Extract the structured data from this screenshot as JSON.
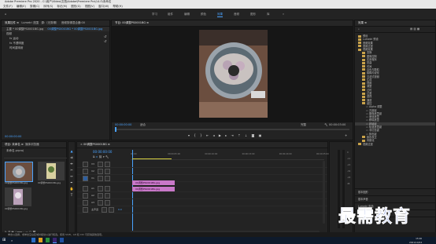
{
  "app": {
    "title": "Adobe Premiere Pro 2020 - C:\\用户\\Video\\文档\\Adobe\\Premiere Pro\\14.0\\未命名",
    "menu": [
      "文件(F)",
      "编辑(E)",
      "剪辑(C)",
      "序列(S)",
      "标记(M)",
      "图形(G)",
      "视图(V)",
      "窗口(W)",
      "帮助(H)"
    ],
    "workspaces": [
      "学习",
      "组件",
      "编辑",
      "颜色",
      "效果",
      "音频",
      "图形",
      "库"
    ],
    "active_workspace": "效果"
  },
  "effect_controls": {
    "tabs": [
      "效果控件 ≡",
      "Lumetri 范围",
      "源:（无剪辑）",
      "音频剪辑混合器:00"
    ],
    "source": "主要 * 00调整PS0001BG.jpg",
    "sequence": "00调整PS0001BG * 00调整PS0001BG.jpg",
    "items": [
      "视频",
      "fx  运动",
      "fx  不透明度",
      "时间重映射"
    ],
    "timecode": "00:00:00:00"
  },
  "program_monitor": {
    "tab": "节目: 00调整PS0001BG ≡",
    "timecode_left": "00:00:00:00",
    "fit": "适合",
    "ratio": "完整",
    "timecode_right": "00:00:03:00"
  },
  "effects_panel": {
    "tab": "效果 ≡",
    "items": [
      {
        "label": "预设",
        "indent": 0
      },
      {
        "label": "Lumetri 预设",
        "indent": 0
      },
      {
        "label": "音频效果",
        "indent": 0
      },
      {
        "label": "音频过渡",
        "indent": 0
      },
      {
        "label": "视频效果",
        "indent": 0
      },
      {
        "label": "变换",
        "indent": 1
      },
      {
        "label": "图像控制",
        "indent": 1
      },
      {
        "label": "实用程序",
        "indent": 1
      },
      {
        "label": "扭曲",
        "indent": 1
      },
      {
        "label": "时间",
        "indent": 1
      },
      {
        "label": "杂色与颗粒",
        "indent": 1
      },
      {
        "label": "模糊与锐化",
        "indent": 1
      },
      {
        "label": "沉浸式视频",
        "indent": 1
      },
      {
        "label": "生成",
        "indent": 1
      },
      {
        "label": "视频",
        "indent": 1
      },
      {
        "label": "调整",
        "indent": 1
      },
      {
        "label": "过时",
        "indent": 1
      },
      {
        "label": "过渡",
        "indent": 1
      },
      {
        "label": "透视",
        "indent": 1
      },
      {
        "label": "通道",
        "indent": 1
      },
      {
        "label": "键控",
        "indent": 1
      },
      {
        "label": "Alpha 调整",
        "indent": 2
      },
      {
        "label": "亮度键",
        "indent": 2
      },
      {
        "label": "图像遮罩键",
        "indent": 2
      },
      {
        "label": "差值遮罩",
        "indent": 2
      },
      {
        "label": "移除遮罩",
        "indent": 2
      },
      {
        "label": "超级键",
        "indent": 2
      },
      {
        "label": "轨道遮罩键",
        "indent": 2
      },
      {
        "label": "非红色键",
        "indent": 2
      },
      {
        "label": "颜色键",
        "indent": 2
      },
      {
        "label": "颜色校正",
        "indent": 1
      },
      {
        "label": "风格化",
        "indent": 1
      },
      {
        "label": "视频过渡",
        "indent": 0
      }
    ],
    "highlighted_index": 26,
    "bottom_items": [
      "基本图形",
      "基本声音",
      "Lumetri 颜色",
      "库",
      "标记"
    ]
  },
  "project": {
    "tabs": [
      "项目: 未命名 ≡",
      "媒体浏览器"
    ],
    "name": "未命名.prproj",
    "thumbs": [
      "00调整PS0001BG.jpg",
      "00调整PS0001BG.jpg",
      "00调整PS0001BG.jpg"
    ]
  },
  "timeline": {
    "tab": "00调整PS0001BG ≡",
    "timecode": "00:00:00:00",
    "ruler": [
      "00:00",
      "00:00:05:00",
      "00:00:10:00",
      "00:00:15:00",
      "00:00:20:00",
      "00:00:25:00"
    ],
    "tracks": [
      "V3",
      "V2",
      "V1",
      "A1",
      "A2",
      "A3",
      "主声道"
    ],
    "master_value": "0.0",
    "clips": [
      "00调整PS0001BG.jpg",
      "00调整PS0001BG.jpg"
    ],
    "status": "单击以选择，或单击空白区域并拖动以进行框选。使用 Shift、Alt 和 Ctrl 可获得其他选项。"
  },
  "watermark": "最需教育",
  "taskbar": {
    "time": "15:00",
    "date": "2021/10/24"
  },
  "colors": {
    "accent": "#4aa3ff",
    "clip": "#c878c8",
    "playhead": "#4aa3ff",
    "folder": "#c9a24a"
  }
}
